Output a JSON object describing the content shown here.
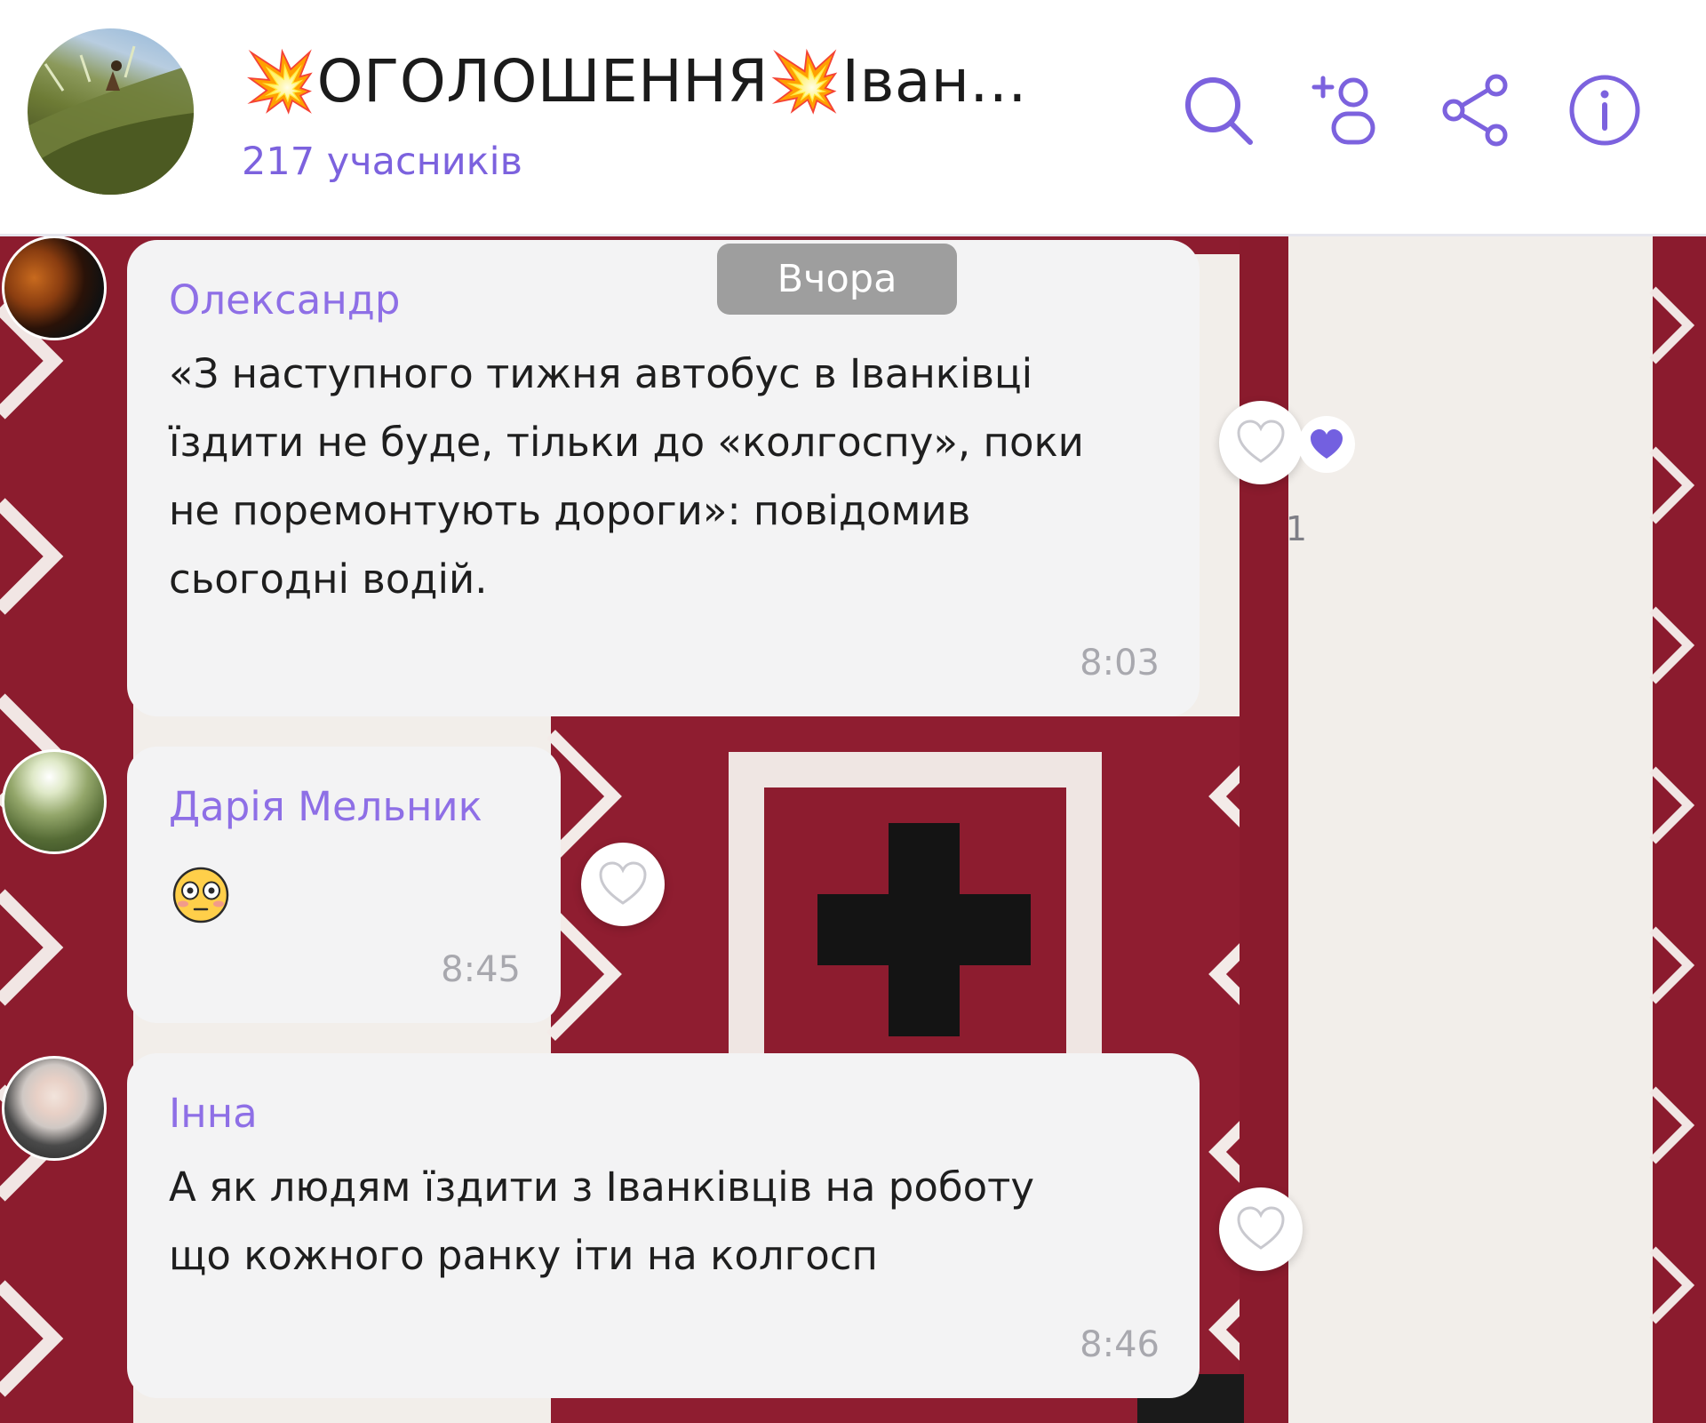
{
  "header": {
    "title": "💥ОГОЛОШЕННЯ💥Іван...",
    "members": "217 учасників",
    "actions": [
      {
        "name": "search-icon"
      },
      {
        "name": "add-participant-icon"
      },
      {
        "name": "share-icon"
      },
      {
        "name": "info-icon"
      }
    ],
    "accent_color": "#7c62de"
  },
  "date_separator": "Вчора",
  "messages": [
    {
      "sender": "Олександр",
      "text": "«З наступного тижня автобус в Іванківці\nїздити не буде, тільки до «колгоспу», поки\nне поремонтують дороги»: повідомив\nсьогодні водій.",
      "time": "8:03",
      "reaction": {
        "icon": "heart-filled-icon",
        "count": "1"
      }
    },
    {
      "sender": "Дарія Мельник",
      "emoji": "flushed-face-icon",
      "time": "8:45"
    },
    {
      "sender": "Інна",
      "text": "А як людям їздити з Іванківців на роботу\nщо кожного ранку іти на колгосп",
      "time": "8:46"
    }
  ],
  "colors": {
    "sender_name": "#8e6fe6",
    "bubble": "#f3f3f4",
    "reaction_heart": "#7360e0"
  }
}
